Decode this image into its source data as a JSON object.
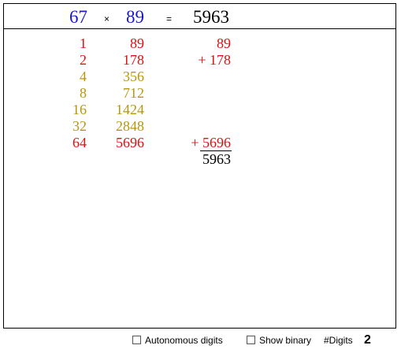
{
  "header": {
    "multiplicand": "67",
    "times_symbol": "×",
    "multiplier": "89",
    "equals_symbol": "=",
    "product": "5963"
  },
  "rows": [
    {
      "power": "1",
      "value": "89",
      "partial": "89",
      "selected": true
    },
    {
      "power": "2",
      "value": "178",
      "partial": "+ 178",
      "selected": true
    },
    {
      "power": "4",
      "value": "356",
      "partial": "",
      "selected": false
    },
    {
      "power": "8",
      "value": "712",
      "partial": "",
      "selected": false
    },
    {
      "power": "16",
      "value": "1424",
      "partial": "",
      "selected": false
    },
    {
      "power": "32",
      "value": "2848",
      "partial": "",
      "selected": false
    },
    {
      "power": "64",
      "value": "5696",
      "partial": "+ 5696",
      "selected": true
    }
  ],
  "total": "5963",
  "footer": {
    "autonomous_digits_label": "Autonomous digits",
    "autonomous_digits_checked": false,
    "show_binary_label": "Show binary",
    "show_binary_checked": false,
    "digits_label": "#Digits",
    "digits_value": "2"
  },
  "colors": {
    "header_numbers": "#1a1acc",
    "selected_row": "#dd1111",
    "unselected_row": "#b8960c",
    "text": "#000000"
  }
}
